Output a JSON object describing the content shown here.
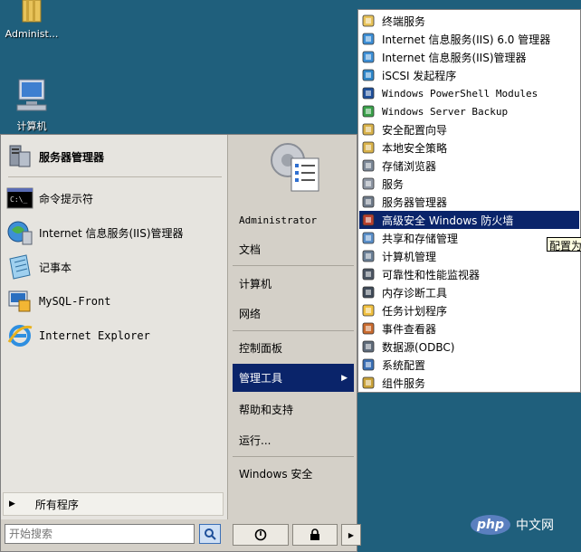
{
  "desktop": {
    "icons": [
      {
        "label": "Administ..."
      },
      {
        "label": "计算机"
      }
    ]
  },
  "start_menu": {
    "pinned_top": {
      "label": "服务器管理器"
    },
    "pinned": [
      {
        "label": "命令提示符"
      },
      {
        "label": "Internet 信息服务(IIS)管理器"
      },
      {
        "label": "记事本"
      },
      {
        "label": "MySQL-Front"
      },
      {
        "label": "Internet Explorer"
      }
    ],
    "all_programs": "所有程序",
    "search_placeholder": "开始搜索",
    "right": [
      {
        "label": "Administrator"
      },
      {
        "label": "文档"
      },
      {
        "label": "计算机"
      },
      {
        "label": "网络"
      },
      {
        "label": "控制面板"
      },
      {
        "label": "管理工具"
      },
      {
        "label": "帮助和支持"
      },
      {
        "label": "运行..."
      },
      {
        "label": "Windows 安全"
      }
    ]
  },
  "submenu": {
    "items": [
      {
        "label": "终端服务",
        "icon": "folder-icon"
      },
      {
        "label": "Internet 信息服务(IIS) 6.0 管理器",
        "icon": "iis-icon"
      },
      {
        "label": "Internet 信息服务(IIS)管理器",
        "icon": "iis-icon"
      },
      {
        "label": "iSCSI 发起程序",
        "icon": "globe-icon"
      },
      {
        "label": "Windows PowerShell Modules",
        "icon": "powershell-icon"
      },
      {
        "label": "Windows Server Backup",
        "icon": "backup-icon"
      },
      {
        "label": "安全配置向导",
        "icon": "security-icon"
      },
      {
        "label": "本地安全策略",
        "icon": "security-icon"
      },
      {
        "label": "存储浏览器",
        "icon": "storage-icon"
      },
      {
        "label": "服务",
        "icon": "gear-icon"
      },
      {
        "label": "服务器管理器",
        "icon": "server-icon"
      },
      {
        "label": "高级安全 Windows 防火墙",
        "icon": "firewall-icon"
      },
      {
        "label": "共享和存储管理",
        "icon": "share-icon"
      },
      {
        "label": "计算机管理",
        "icon": "computer-icon"
      },
      {
        "label": "可靠性和性能监视器",
        "icon": "monitor-icon"
      },
      {
        "label": "内存诊断工具",
        "icon": "memory-icon"
      },
      {
        "label": "任务计划程序",
        "icon": "clock-icon"
      },
      {
        "label": "事件查看器",
        "icon": "event-icon"
      },
      {
        "label": "数据源(ODBC)",
        "icon": "database-icon"
      },
      {
        "label": "系统配置",
        "icon": "config-icon"
      },
      {
        "label": "组件服务",
        "icon": "component-icon"
      }
    ],
    "highlighted_index": 11
  },
  "tooltip": "配置为",
  "watermark": {
    "badge": "php",
    "text": "中文网"
  }
}
